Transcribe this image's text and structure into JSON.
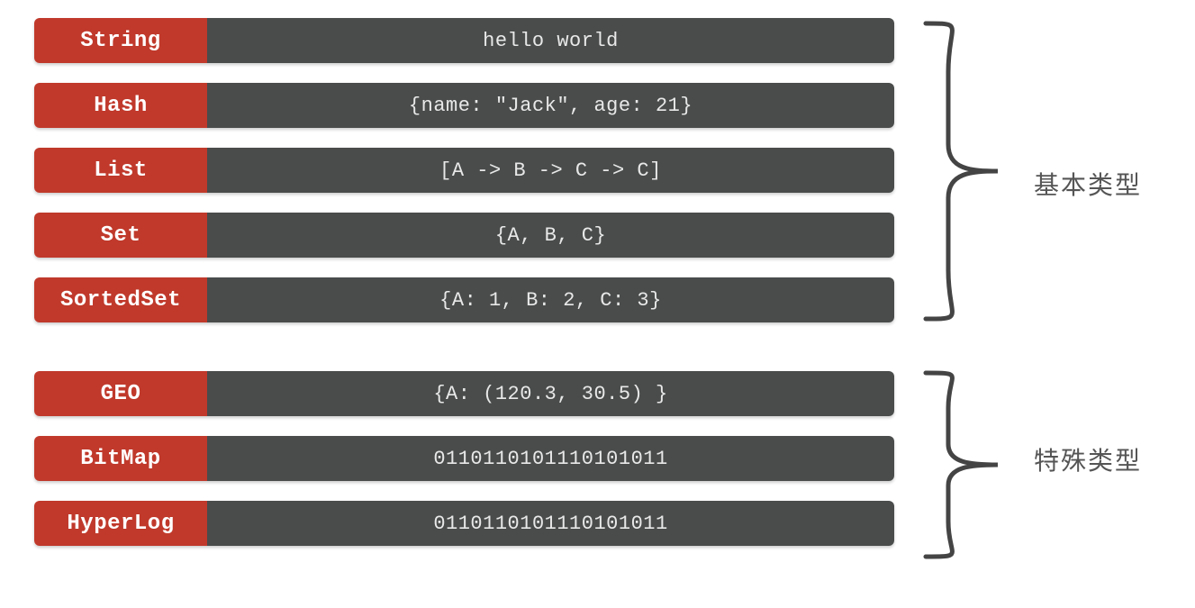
{
  "groups": {
    "basic_label": "基本类型",
    "special_label": "特殊类型"
  },
  "rows": [
    {
      "type": "String",
      "value": "hello world",
      "group": "basic"
    },
    {
      "type": "Hash",
      "value": "{name: \"Jack\", age: 21}",
      "group": "basic"
    },
    {
      "type": "List",
      "value": "[A -> B -> C -> C]",
      "group": "basic"
    },
    {
      "type": "Set",
      "value": "{A, B, C}",
      "group": "basic"
    },
    {
      "type": "SortedSet",
      "value": "{A: 1, B: 2, C: 3}",
      "group": "basic"
    },
    {
      "type": "GEO",
      "value": "{A: (120.3,  30.5) }",
      "group": "special"
    },
    {
      "type": "BitMap",
      "value": "0110110101110101011",
      "group": "special"
    },
    {
      "type": "HyperLog",
      "value": "0110110101110101011",
      "group": "special"
    }
  ]
}
